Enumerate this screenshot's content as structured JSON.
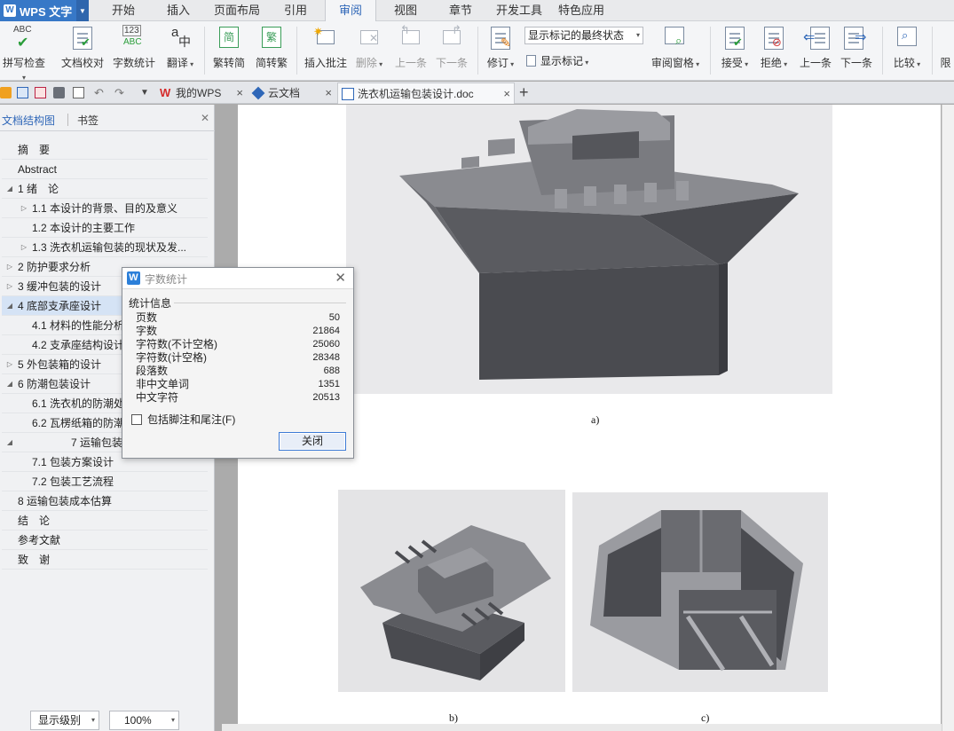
{
  "app": {
    "name": "WPS 文字"
  },
  "menu": {
    "tabs": [
      {
        "label": "开始"
      },
      {
        "label": "插入"
      },
      {
        "label": "页面布局"
      },
      {
        "label": "引用"
      },
      {
        "label": "审阅"
      },
      {
        "label": "视图"
      },
      {
        "label": "章节"
      },
      {
        "label": "开发工具"
      },
      {
        "label": "特色应用"
      }
    ],
    "active": "审阅"
  },
  "ribbon": {
    "spell": "拼写检查",
    "proof": "文档校对",
    "wordcount": "字数统计",
    "translate": "翻译",
    "trad2simp": "繁转简",
    "simp2trad": "简转繁",
    "insert_comment": "插入批注",
    "delete": "删除",
    "prev_comment": "上一条",
    "next_comment": "下一条",
    "track": "修订",
    "markup_state": "显示标记的最终状态",
    "show_markup": "显示标记",
    "review_pane": "审阅窗格",
    "accept": "接受",
    "reject": "拒绝",
    "prev_change": "上一条",
    "next_change": "下一条",
    "compare": "比较",
    "restrict": "限"
  },
  "tabs": {
    "docs": [
      {
        "label": "我的WPS"
      },
      {
        "label": "云文档"
      },
      {
        "label": "洗衣机运输包装设计.doc"
      }
    ],
    "add": "+"
  },
  "nav": {
    "tab_structure": "文档结构图",
    "tab_bookmark": "书签",
    "items": [
      {
        "label": "摘　要"
      },
      {
        "label": "Abstract"
      },
      {
        "label": "1 绪　论"
      },
      {
        "label": "1.1 本设计的背景、目的及意义"
      },
      {
        "label": "1.2 本设计的主要工作"
      },
      {
        "label": "1.3 洗衣机运输包装的现状及发..."
      },
      {
        "label": "2 防护要求分析"
      },
      {
        "label": "3 缓冲包装的设计"
      },
      {
        "label": "4 底部支承座设计"
      },
      {
        "label": "4.1 材料的性能分析"
      },
      {
        "label": "4.2 支承座结构设计"
      },
      {
        "label": "5 外包装箱的设计"
      },
      {
        "label": "6 防潮包装设计"
      },
      {
        "label": "6.1 洗衣机的防潮处理"
      },
      {
        "label": "6.2 瓦楞纸箱的防潮处理"
      },
      {
        "label": "7 运输包装"
      },
      {
        "label": "7.1 包装方案设计"
      },
      {
        "label": "7.2 包装工艺流程"
      },
      {
        "label": "8 运输包装成本估算"
      },
      {
        "label": "结　论"
      },
      {
        "label": "参考文献"
      },
      {
        "label": "致　谢"
      }
    ],
    "level_label": "显示级别",
    "zoom": "100%"
  },
  "document": {
    "captions": {
      "a": "a)",
      "b": "b)",
      "c": "c)"
    }
  },
  "dialog": {
    "title": "字数统计",
    "group": "统计信息",
    "stats": [
      {
        "label": "页数",
        "value": "50"
      },
      {
        "label": "字数",
        "value": "21864"
      },
      {
        "label": "字符数(不计空格)",
        "value": "25060"
      },
      {
        "label": "字符数(计空格)",
        "value": "28348"
      },
      {
        "label": "段落数",
        "value": "688"
      },
      {
        "label": "非中文单词",
        "value": "1351"
      },
      {
        "label": "中文字符",
        "value": "20513"
      }
    ],
    "include_footnotes": "包括脚注和尾注(F)",
    "close": "关闭"
  },
  "colors": {
    "accent": "#2f67b8",
    "app_blue": "#3778c7"
  }
}
